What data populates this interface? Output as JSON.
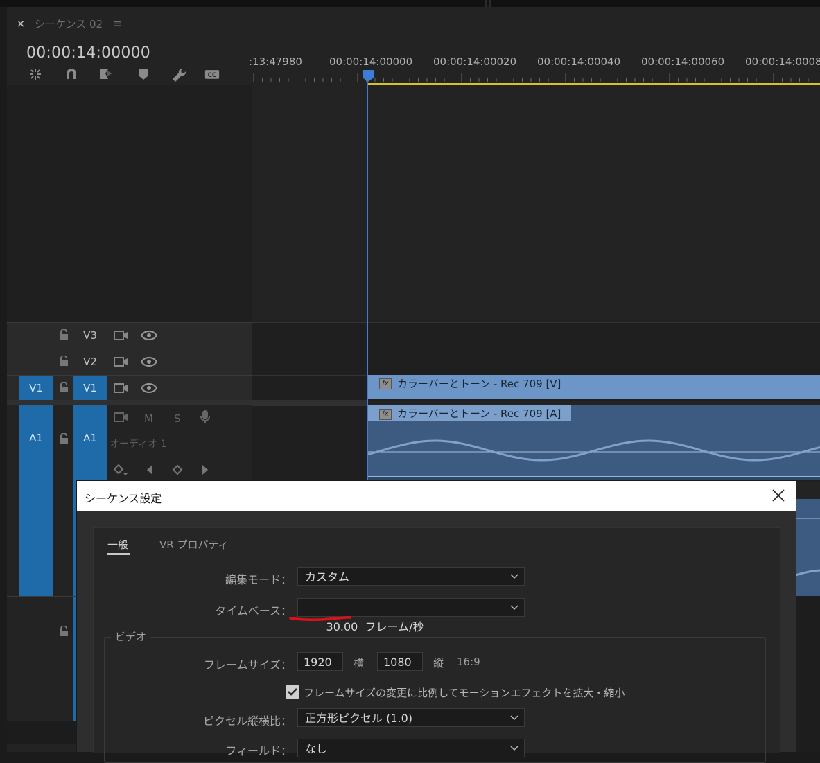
{
  "tab": {
    "close": "×",
    "title": "シーケンス 02",
    "menu": "≡"
  },
  "timecode": "00:00:14:00000",
  "toolbar": {
    "tools": [
      "snap-icon",
      "magnet-icon",
      "linked-selection-icon",
      "marker-icon",
      "wrench-icon",
      "captions-icon"
    ],
    "cc_label": "CC"
  },
  "ruler": {
    "labels": [
      ":13:47980",
      "00:00:14:00000",
      "00:00:14:00020",
      "00:00:14:00040",
      "00:00:14:00060",
      "00:00:14:0008"
    ]
  },
  "tracks": {
    "v3": {
      "target": "V3"
    },
    "v2": {
      "target": "V2"
    },
    "v1": {
      "source": "V1",
      "target": "V1"
    },
    "a1": {
      "source": "A1",
      "target": "A1",
      "mute": "M",
      "solo": "S",
      "name": "オーディオ 1"
    }
  },
  "clips": {
    "video": {
      "fx": "fx",
      "label": "カラーバーとトーン - Rec 709 [V]"
    },
    "audio": {
      "fx": "fx",
      "label": "カラーバーとトーン - Rec 709 [A]"
    }
  },
  "dialog": {
    "title": "シーケンス設定",
    "tabs": [
      "一般",
      "VR プロパティ"
    ],
    "edit_mode_label": "編集モード：",
    "edit_mode_value": "カスタム",
    "timebase_label": "タイムベース：",
    "timebase_value": "30.00  フレーム/秒",
    "video_group": "ビデオ",
    "frame_size_label": "フレームサイズ：",
    "frame_width": "1920",
    "width_unit": "横",
    "frame_height": "1080",
    "height_unit": "縦",
    "aspect": "16:9",
    "scale_checkbox_label": "フレームサイズの変更に比例してモーションエフェクトを拡大・縮小",
    "scale_checked": true,
    "pixel_aspect_label": "ピクセル縦横比：",
    "pixel_aspect_value": "正方形ピクセル (1.0)",
    "fields_label": "フィールド：",
    "fields_value": "なし"
  },
  "colors": {
    "accent_blue": "#1f6aa8",
    "playhead": "#3d7dd6",
    "work_area": "#d6c22c",
    "video_clip": "#6d96c8",
    "audio_clip": "#3d5a80",
    "annotation_red": "#e0101a"
  }
}
